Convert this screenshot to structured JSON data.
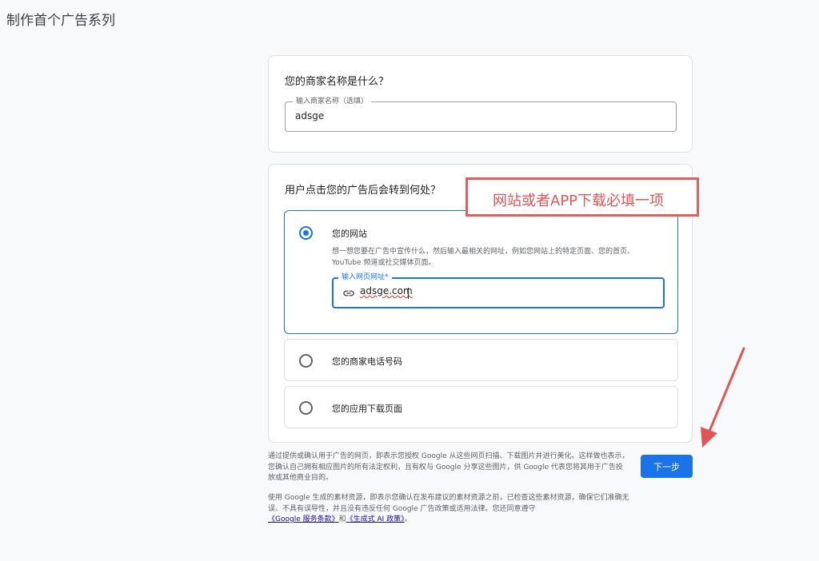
{
  "page": {
    "title": "制作首个广告系列"
  },
  "business": {
    "question": "您的商家名称是什么？",
    "field_label": "输入商家名称（选填）",
    "field_value": "adsge"
  },
  "destination": {
    "question": "用户点击您的广告后会转到何处？",
    "options": [
      {
        "label": "您的网站",
        "selected": true,
        "description": "想一想您要在广告中宣传什么，然后输入最相关的网址，例如您网站上的特定页面、您的首页、YouTube 频道或社交媒体页面。",
        "url_label": "输入网页网址*",
        "url_value": "adsge.com",
        "url_icon": "link-icon"
      },
      {
        "label": "您的商家电话号码",
        "selected": false
      },
      {
        "label": "您的应用下载页面",
        "selected": false
      }
    ]
  },
  "annotation": {
    "text": "网站或者APP下载必填一项",
    "color": "#e05656"
  },
  "legal": {
    "paragraph1": "通过提供或确认用于广告的网页，即表示您授权 Google 从这些网页扫描、下载图片并进行美化。这样做也表示，您确认自己拥有相应图片的所有法定权利，且有权与 Google 分享这些图片，供 Google 代表您将其用于广告投放或其他商业目的。",
    "paragraph2_text": "使用 Google 生成的素材资源，即表示您确认在发布建议的素材资源之前，已检查这些素材资源，确保它们准确无误、不具有误导性，并且没有违反任何 Google 广告政策或适用法律。您还同意遵守",
    "link1": "《Google 服务条款》",
    "joiner": "和",
    "link2": "《生成式 AI 政策》",
    "end": "。"
  },
  "actions": {
    "next_label": "下一步"
  },
  "colors": {
    "accent": "#1a73e8",
    "annotation": "#e06060"
  }
}
